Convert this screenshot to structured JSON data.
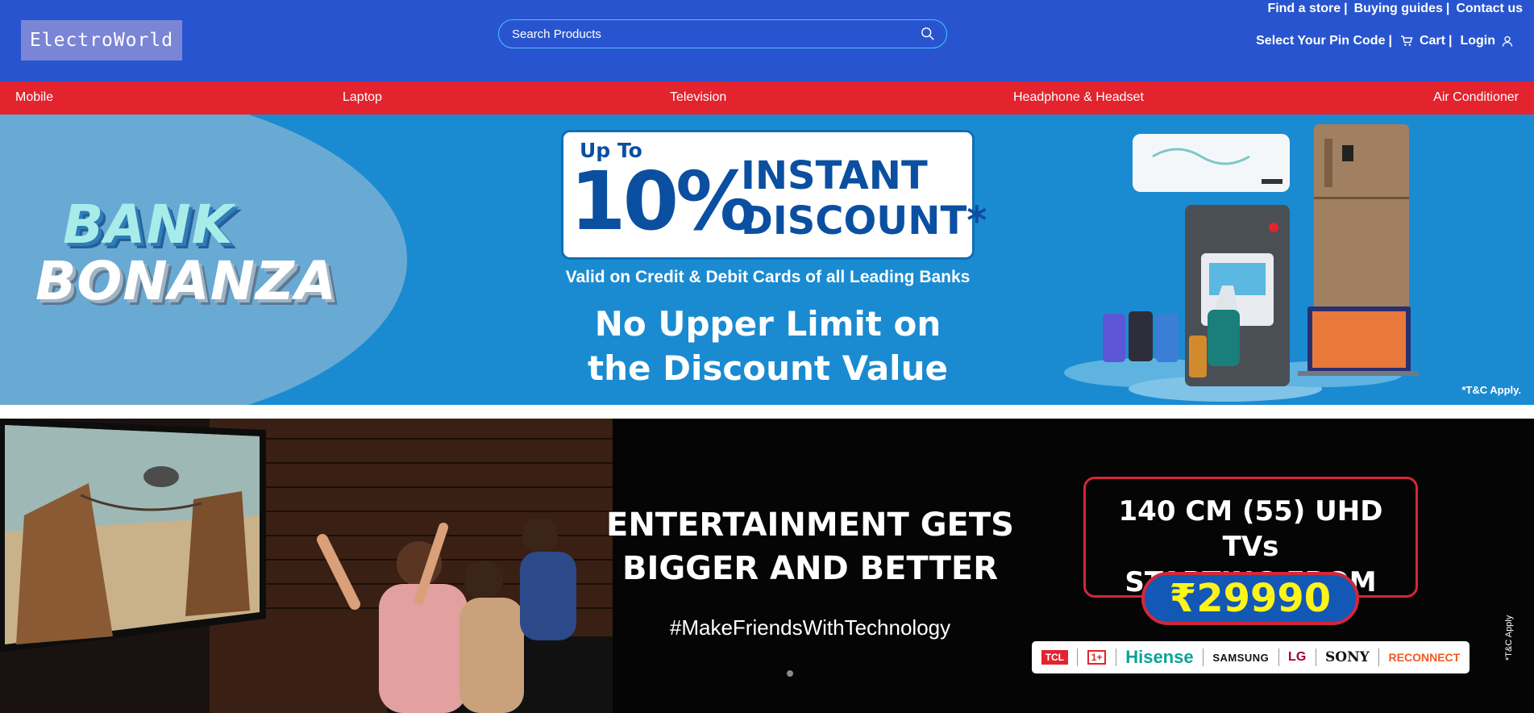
{
  "header": {
    "logo": "ElectroWorld",
    "search": {
      "placeholder": "Search Products"
    },
    "top_links": [
      "Find a store",
      "Buying guides",
      "Contact us"
    ],
    "pin_code": "Select Your Pin Code",
    "cart": "Cart",
    "login": "Login",
    "separator": "|"
  },
  "nav": {
    "items": [
      "Mobile",
      "Laptop",
      "Television",
      "Headphone & Headset",
      "Air Conditioner"
    ]
  },
  "banner1": {
    "title_line1": "BANK",
    "title_line2": "BONANZA",
    "up_to": "Up To",
    "percent": "10%",
    "instant": "INSTANT",
    "discount": "DISCOUNT*",
    "valid": "Valid on Credit & Debit Cards of all Leading Banks",
    "no_limit_line1": "No Upper Limit on",
    "no_limit_line2": "the Discount Value",
    "tc": "*T&C Apply."
  },
  "banner2": {
    "headline_line1": "ENTERTAINMENT GETS",
    "headline_line2": "BIGGER AND BETTER",
    "hashtag": "#MakeFriendsWithTechnology",
    "uhd_line1": "140 CM (55) UHD TVs",
    "uhd_line2": "STARTING FROM",
    "price": "₹29990",
    "brands": [
      "TCL",
      "1+",
      "Hisense",
      "SAMSUNG",
      "LG",
      "SONY",
      "RECONNECT"
    ],
    "tc": "*T&C Apply"
  },
  "colors": {
    "header_bg": "#2855cf",
    "nav_bg": "#e3232e",
    "banner1_bg": "#1b8bd1",
    "price_text": "#fff41a"
  }
}
